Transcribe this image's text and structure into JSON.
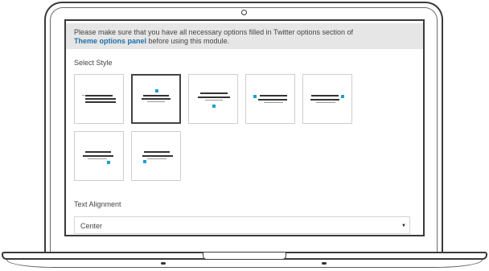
{
  "notice": {
    "text_before": "Please make sure that you have all necessary options filled in Twitter options section of",
    "link_text": "Theme options panel",
    "text_after": " before using this module."
  },
  "select_style": {
    "label": "Select Style",
    "tiles": [
      {
        "name": "style-avatar-left-top-lines",
        "selected": false
      },
      {
        "name": "style-avatar-top-centered",
        "selected": true
      },
      {
        "name": "style-avatar-bottom-centered",
        "selected": false
      },
      {
        "name": "style-avatar-left-inline",
        "selected": false
      },
      {
        "name": "style-avatar-right-inline",
        "selected": false
      },
      {
        "name": "style-avatar-bottom-right",
        "selected": false
      },
      {
        "name": "style-avatar-bottom-left",
        "selected": false
      }
    ]
  },
  "text_alignment": {
    "label": "Text Alignment",
    "value": "Center"
  },
  "colors": {
    "accent": "#1aa0cc",
    "link": "#1e6fa8",
    "notice_bg": "#e6e6e6"
  }
}
